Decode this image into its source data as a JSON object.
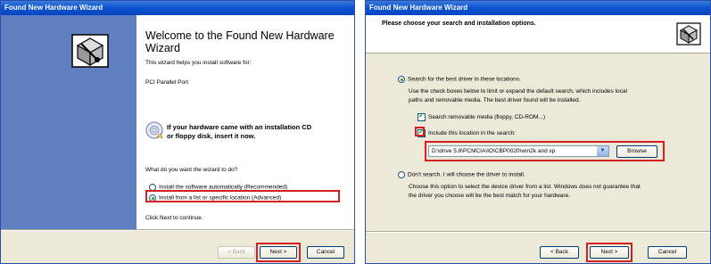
{
  "left_window": {
    "title": "Found New Hardware Wizard",
    "heading": "Welcome to the Found New Hardware Wizard",
    "intro": "This wizard helps you install software for:",
    "device": "PCI Parallel Port",
    "cd_prompt_line1": "If your hardware came with an installation CD",
    "cd_prompt_line2": "or floppy disk, insert it now.",
    "question": "What do you want the wizard to do?",
    "option_auto": "Install the software automatically (Recommended)",
    "option_list": "Install from a list or specific location (Advanced)",
    "selected_option": "option_list",
    "continue_hint": "Click Next to continue.",
    "back_label": "< Back",
    "next_label": "Next >",
    "cancel_label": "Cancel"
  },
  "right_window": {
    "title": "Found New Hardware Wizard",
    "header": "Please choose your search and installation options.",
    "option_search": "Search for the best driver in these locations.",
    "search_desc_line1": "Use the check boxes below to limit or expand the default search, which includes local",
    "search_desc_line2": "paths and removable media. The best driver found will be installed.",
    "cb_removable": "Search removable media (floppy, CD-ROM...)",
    "cb_include": "Include this location in the search:",
    "path_value": "D:\\drive 5.8\\PCMCIA\\IO\\CBP0020\\win2k and xp",
    "browse_label": "Browse",
    "option_dont": "Don't search. I will choose the driver to install.",
    "dont_desc_line1": "Choose this option to select the device driver from a list.  Windows does not guarantee that",
    "dont_desc_line2": "the driver you choose will be the best match for your hardware.",
    "back_label": "< Back",
    "next_label": "Next >",
    "cancel_label": "Cancel"
  },
  "colors": {
    "titlebar": "#0a52d0",
    "side_panel": "#5f7fc0",
    "highlight_box": "#d42020",
    "dialog_bg": "#ece9d8"
  },
  "icons": [
    "hardware-wizard-icon",
    "cd-icon",
    "hardware-wizard-icon"
  ]
}
